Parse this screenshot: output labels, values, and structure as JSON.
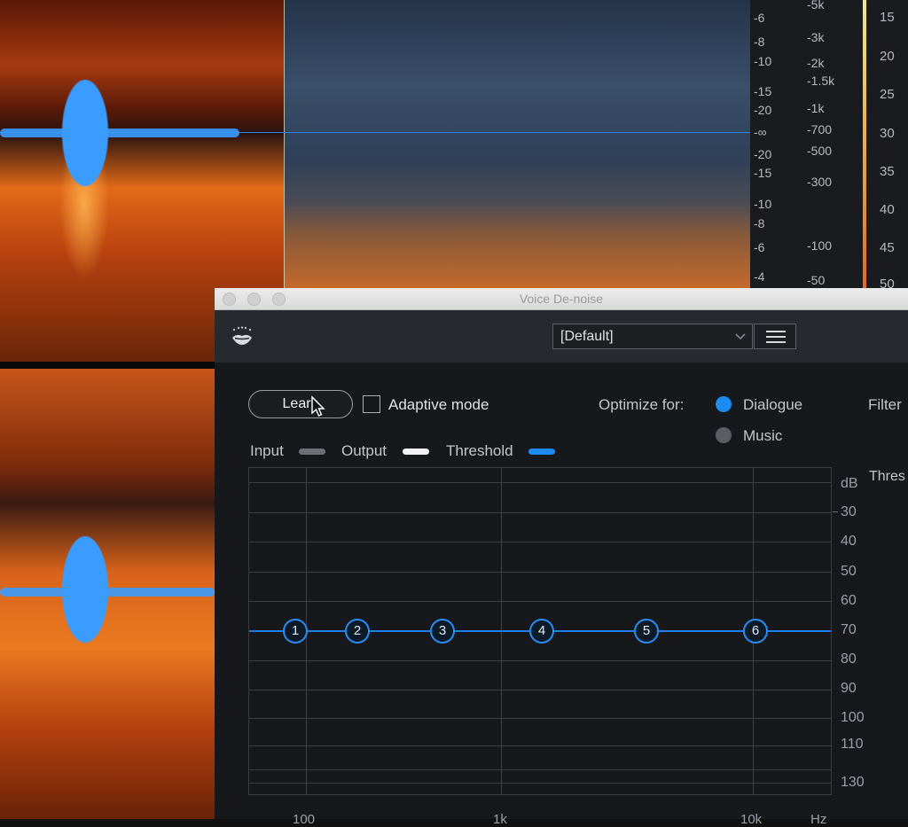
{
  "editor": {
    "scale_labels": {
      "db": [
        "-6",
        "-8",
        "-10",
        "-15",
        "-20",
        "-∞",
        "-20",
        "-15",
        "-10",
        "-8",
        "-6",
        "-4"
      ],
      "freq": [
        "-5k",
        "-3k",
        "-2k",
        "-1.5k",
        "-1k",
        "-700",
        "-500",
        "-300",
        "-100",
        "-50"
      ]
    },
    "meter_labels": [
      "15",
      "20",
      "25",
      "30",
      "35",
      "40",
      "45",
      "50"
    ]
  },
  "window": {
    "title": "Voice De-noise",
    "preset_value": "[Default]"
  },
  "controls": {
    "learn_label": "Learn",
    "adaptive_label": "Adaptive mode",
    "optimize_label": "Optimize for:",
    "dialogue_label": "Dialogue",
    "music_label": "Music",
    "filter_label": "Filter",
    "threshold_right_label": "Thres",
    "selected_mode": "Dialogue",
    "adaptive_checked": false
  },
  "legend": {
    "input": "Input",
    "output": "Output",
    "threshold": "Threshold",
    "colors": {
      "input": "#6b7077",
      "output": "#f2f2f2",
      "threshold": "#1d8bf0"
    }
  },
  "graph": {
    "db_labels": [
      "dB",
      "30",
      "40",
      "50",
      "60",
      "70",
      "80",
      "90",
      "100",
      "110",
      "130"
    ],
    "hz_labels": [
      "100",
      "1k",
      "10k",
      "Hz"
    ],
    "threshold_db": 70,
    "nodes": [
      "1",
      "2",
      "3",
      "4",
      "5",
      "6"
    ]
  },
  "colors": {
    "accent": "#1d8bf0",
    "window_bg": "#16181b",
    "toolbar_bg": "#26292d"
  }
}
